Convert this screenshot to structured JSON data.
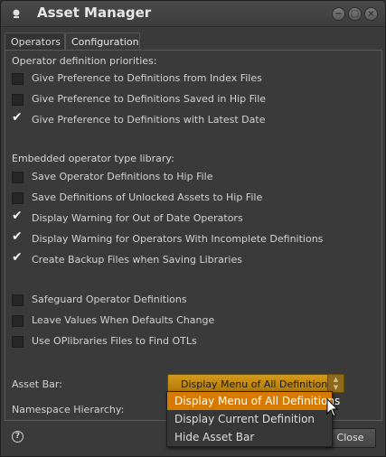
{
  "window": {
    "title": "Asset Manager",
    "controls": {
      "minimize": "−",
      "maximize": "□",
      "close": "×"
    }
  },
  "tabs": [
    {
      "label": "Operators",
      "active": false
    },
    {
      "label": "Configuration",
      "active": true
    }
  ],
  "sections": {
    "priorities_label": "Operator definition priorities:",
    "library_label": "Embedded operator type library:"
  },
  "priorities": [
    {
      "label": "Give Preference to Definitions from Index Files",
      "checked": false
    },
    {
      "label": "Give Preference to Definitions Saved in Hip File",
      "checked": false
    },
    {
      "label": "Give Preference to Definitions with Latest Date",
      "checked": true
    }
  ],
  "library": [
    {
      "label": "Save Operator Definitions to Hip File",
      "checked": false
    },
    {
      "label": "Save Definitions of Unlocked Assets to Hip File",
      "checked": false
    },
    {
      "label": "Display Warning for Out of Date Operators",
      "checked": true
    },
    {
      "label": "Display Warning for Operators With Incomplete Definitions",
      "checked": true
    },
    {
      "label": "Create Backup Files when Saving Libraries",
      "checked": true
    }
  ],
  "misc": [
    {
      "label": "Safeguard Operator Definitions",
      "checked": false
    },
    {
      "label": "Leave Values When Defaults Change",
      "checked": false
    },
    {
      "label": "Use OPlibraries Files to Find OTLs",
      "checked": false
    }
  ],
  "asset_bar": {
    "label": "Asset Bar:",
    "value": "Display Menu of All Definitions",
    "options": [
      "Display Menu of All Definitions",
      "Display Current Definition",
      "Hide Asset Bar"
    ],
    "highlighted_index": 0
  },
  "namespace": {
    "label": "Namespace Hierarchy:"
  },
  "footer": {
    "help_icon": "?",
    "close_label": "Close"
  },
  "colors": {
    "accent": "#d97a00",
    "combo": "#c98a14"
  }
}
